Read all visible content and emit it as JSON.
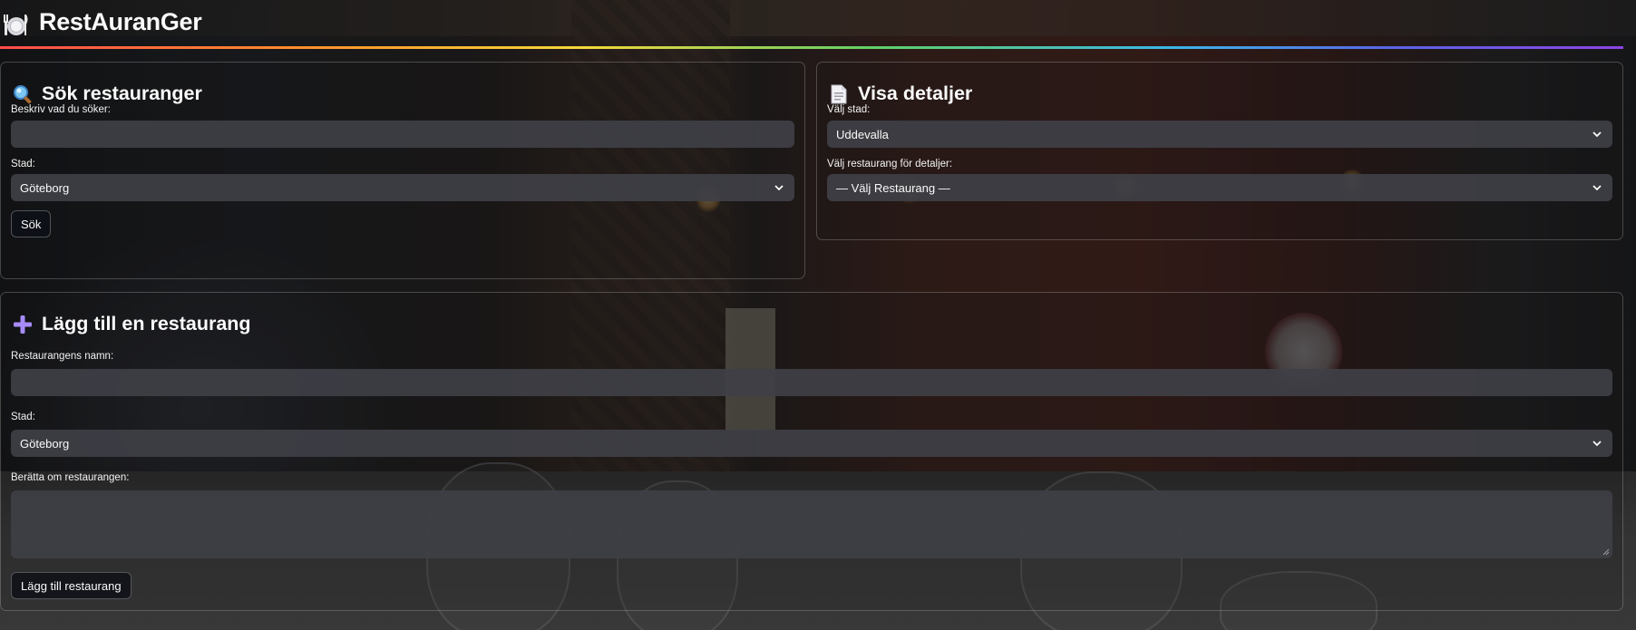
{
  "app": {
    "title": "RestAuranGer",
    "logo_icon": "plate-cutlery-icon"
  },
  "search": {
    "title": "Sök restauranger",
    "icon": "magnifier-icon",
    "query_label": "Beskriv vad du söker:",
    "query_value": "",
    "city_label": "Stad:",
    "city_value": "Göteborg",
    "button_label": "Sök"
  },
  "details": {
    "title": "Visa detaljer",
    "icon": "document-icon",
    "city_label": "Välj stad:",
    "city_value": "Uddevalla",
    "restaurant_label": "Välj restaurang för detaljer:",
    "restaurant_value": "— Välj Restaurang —"
  },
  "add": {
    "title": "Lägg till en restaurang",
    "icon": "plus-icon",
    "name_label": "Restaurangens namn:",
    "name_value": "",
    "city_label": "Stad:",
    "city_value": "Göteborg",
    "description_label": "Berätta om restaurangen:",
    "description_value": "",
    "button_label": "Lägg till restaurang"
  },
  "colors": {
    "accent_icon": "#a78bfa",
    "field_bg": "#3e4046",
    "button_bg": "#0e1117"
  }
}
